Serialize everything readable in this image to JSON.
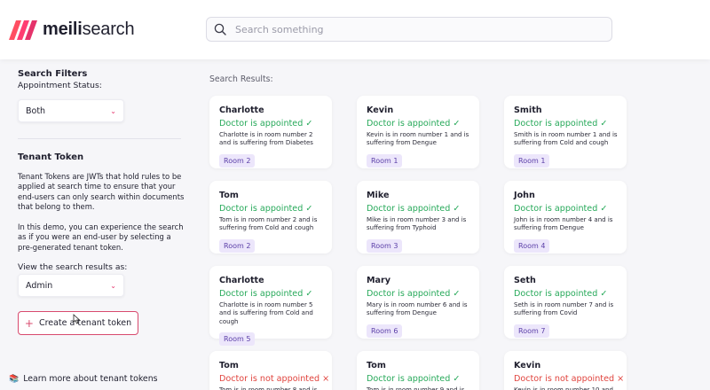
{
  "brand": {
    "name_bold": "meili",
    "name_rest": "search",
    "accent": "#ff4e62"
  },
  "search": {
    "placeholder": "Search something",
    "value": ""
  },
  "sidebar": {
    "filters_title": "Search Filters",
    "status_label": "Appointment Status:",
    "status_selected": "Both",
    "tenant_title": "Tenant Token",
    "paragraph1": "Tenant Tokens are JWTs that hold rules to be applied at search time to ensure that your end-users can only search within documents that belong to them.",
    "paragraph2": "In this demo, you can experience the search as if you were an end-user by selecting a pre-generated tenant token.",
    "view_label": "View the search results as:",
    "view_selected": "Admin",
    "create_button": "Create a tenant token",
    "learn_link": "Learn more about tenant tokens"
  },
  "results": {
    "label": "Search Results:",
    "cards": [
      {
        "name": "Charlotte",
        "status": "Doctor is appointed ✓",
        "appointed": true,
        "info": "Charlotte is in room number 2 and is suffering from Diabetes",
        "room": "Room 2"
      },
      {
        "name": "Kevin",
        "status": "Doctor is appointed ✓",
        "appointed": true,
        "info": "Kevin is in room number 1 and is suffering from Dengue",
        "room": "Room 1"
      },
      {
        "name": "Smith",
        "status": "Doctor is appointed ✓",
        "appointed": true,
        "info": "Smith is in room number 1 and is suffering from Cold and cough",
        "room": "Room 1"
      },
      {
        "name": "Tom",
        "status": "Doctor is appointed ✓",
        "appointed": true,
        "info": "Tom is in room number 2 and is suffering from Cold and cough",
        "room": "Room 2"
      },
      {
        "name": "Mike",
        "status": "Doctor is appointed ✓",
        "appointed": true,
        "info": "Mike is in room number 3 and is suffering from Typhoid",
        "room": "Room 3"
      },
      {
        "name": "John",
        "status": "Doctor is appointed ✓",
        "appointed": true,
        "info": "John is in room number 4 and is suffering from Dengue",
        "room": "Room 4"
      },
      {
        "name": "Charlotte",
        "status": "Doctor is appointed ✓",
        "appointed": true,
        "info": "Charlotte is in room number 5 and is suffering from Cold and cough",
        "room": "Room 5"
      },
      {
        "name": "Mary",
        "status": "Doctor is appointed ✓",
        "appointed": true,
        "info": "Mary is in room number 6 and is suffering from Dengue",
        "room": "Room 6"
      },
      {
        "name": "Seth",
        "status": "Doctor is appointed ✓",
        "appointed": true,
        "info": "Seth is in room number 7 and is suffering from Covid",
        "room": "Room 7"
      },
      {
        "name": "Tom",
        "status": "Doctor is not appointed ×",
        "appointed": false,
        "info": "Tom is in room number 8 and is",
        "room": ""
      },
      {
        "name": "Tom",
        "status": "Doctor is appointed ✓",
        "appointed": true,
        "info": "Tom is in room number 9 and is",
        "room": ""
      },
      {
        "name": "Kevin",
        "status": "Doctor is not appointed ×",
        "appointed": false,
        "info": "Kevin is in room number 10 and is",
        "room": ""
      }
    ]
  }
}
